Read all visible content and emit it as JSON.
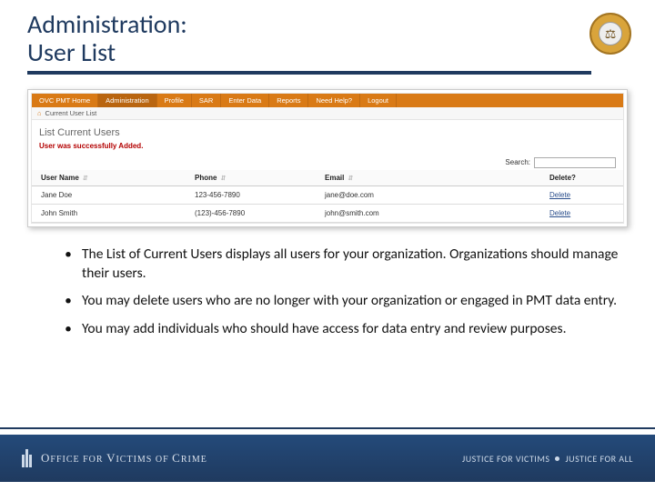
{
  "header": {
    "title_line1": "Administration:",
    "title_line2": "User List"
  },
  "seal": {
    "glyph": "⚖"
  },
  "app": {
    "nav": [
      "OVC PMT Home",
      "Administration",
      "Profile",
      "SAR",
      "Enter Data",
      "Reports",
      "Need Help?",
      "Logout"
    ],
    "active_nav_index": 1,
    "breadcrumb_home_glyph": "⌂",
    "breadcrumb": "Current User List",
    "panel_title": "List Current Users",
    "success_message": "User was successfully Added.",
    "search_label": "Search:",
    "search_value": "",
    "columns": [
      "User Name",
      "Phone",
      "Email",
      "Delete?"
    ],
    "rows": [
      {
        "name": "Jane Doe",
        "phone": "123-456-7890",
        "email": "jane@doe.com",
        "action": "Delete"
      },
      {
        "name": "John Smith",
        "phone": "(123)-456-7890",
        "email": "john@smith.com",
        "action": "Delete"
      }
    ]
  },
  "bullets": [
    "The List of Current Users displays all users for your organization. Organizations should manage their users.",
    "You may delete users who are no longer with your organization or engaged in PMT data entry.",
    "You may add individuals who should have access for data entry and review purposes."
  ],
  "footer": {
    "org_prefix": "O",
    "org_mid1": "FFICE ",
    "org_for": "FOR ",
    "org_V": "V",
    "org_mid2": "ICTIMS ",
    "org_of": "OF ",
    "org_C": "C",
    "org_end": "RIME",
    "tag_left": "JUSTICE FOR VICTIMS",
    "tag_right": "JUSTICE FOR ALL"
  }
}
